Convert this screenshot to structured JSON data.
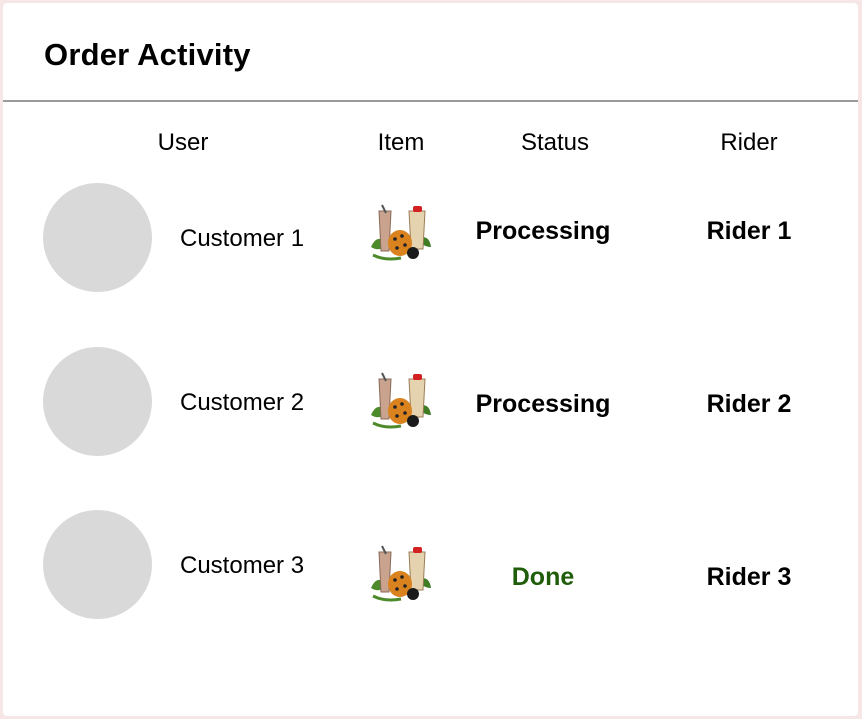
{
  "page": {
    "title": "Order Activity"
  },
  "table": {
    "headers": {
      "user": "User",
      "item": "Item",
      "status": "Status",
      "rider": "Rider"
    },
    "rows": [
      {
        "customer": "Customer 1",
        "item_icon": "boba-drinks-icon",
        "status": "Processing",
        "rider": "Rider 1"
      },
      {
        "customer": "Customer 2",
        "item_icon": "boba-drinks-icon",
        "status": "Processing",
        "rider": "Rider 2"
      },
      {
        "customer": "Customer 3",
        "item_icon": "boba-drinks-icon",
        "status": "Done",
        "rider": "Rider 3"
      }
    ]
  },
  "colors": {
    "done": "#1f5d0b",
    "avatar": "#d9d9d9",
    "divider": "#9a9a9a"
  }
}
